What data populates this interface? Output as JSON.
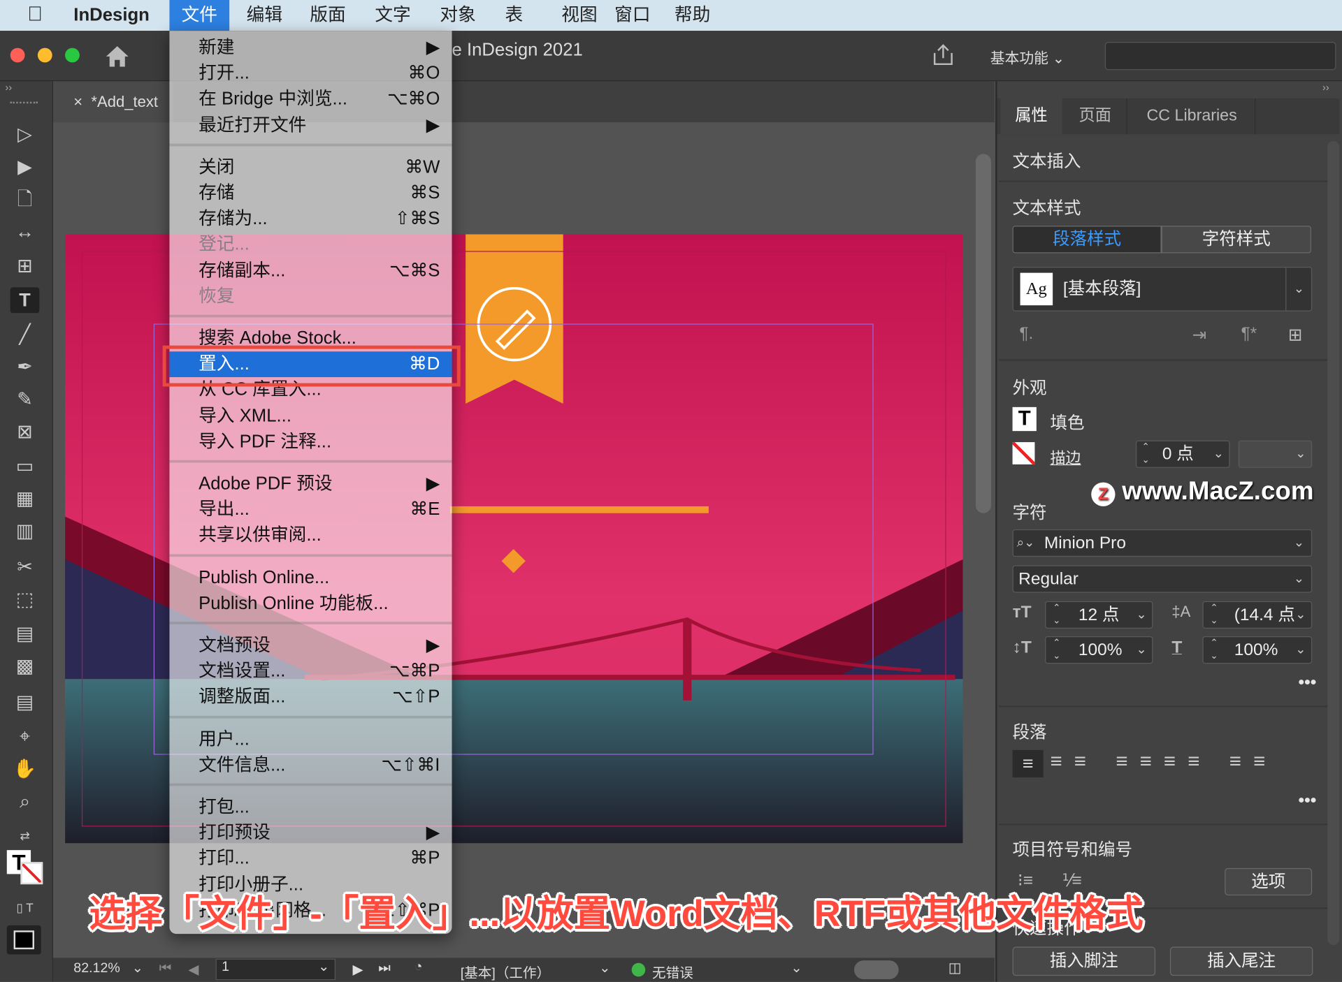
{
  "menubar": {
    "apple_icon": "apple-icon",
    "app_name": "InDesign",
    "items": [
      "文件",
      "编辑",
      "版面",
      "文字",
      "对象",
      "表",
      "视图",
      "窗口",
      "帮助"
    ],
    "active_index": 0
  },
  "window": {
    "title": "Adobe InDesign 2021",
    "title_visible": "e InDesign 2021",
    "workspace": "基本功能",
    "search_placeholder": "",
    "doc_tab": "*Add_text",
    "traffic_lights": [
      "#fe5f57",
      "#febc2e",
      "#28c840"
    ]
  },
  "file_menu": {
    "groups": [
      [
        {
          "label": "新建",
          "shortcut": "▶"
        },
        {
          "label": "打开...",
          "shortcut": "⌘O"
        },
        {
          "label": "在 Bridge 中浏览...",
          "shortcut": "⌥⌘O"
        },
        {
          "label": "最近打开文件",
          "shortcut": "▶"
        }
      ],
      [
        {
          "label": "关闭",
          "shortcut": "⌘W"
        },
        {
          "label": "存储",
          "shortcut": "⌘S"
        },
        {
          "label": "存储为...",
          "shortcut": "⇧⌘S"
        },
        {
          "label": "登记...",
          "shortcut": "",
          "disabled": true
        },
        {
          "label": "存储副本...",
          "shortcut": "⌥⌘S"
        },
        {
          "label": "恢复",
          "shortcut": "",
          "disabled": true
        }
      ],
      [
        {
          "label": "搜索 Adobe Stock...",
          "shortcut": ""
        },
        {
          "label": "置入...",
          "shortcut": "⌘D",
          "highlighted": true
        },
        {
          "label": "从 CC 库置入...",
          "shortcut": ""
        },
        {
          "label": "导入 XML...",
          "shortcut": ""
        },
        {
          "label": "导入 PDF 注释...",
          "shortcut": ""
        }
      ],
      [
        {
          "label": "Adobe PDF 预设",
          "shortcut": "▶"
        },
        {
          "label": "导出...",
          "shortcut": "⌘E"
        },
        {
          "label": "共享以供审阅...",
          "shortcut": ""
        }
      ],
      [
        {
          "label": "Publish Online...",
          "shortcut": ""
        },
        {
          "label": "Publish Online 功能板...",
          "shortcut": ""
        }
      ],
      [
        {
          "label": "文档预设",
          "shortcut": "▶"
        },
        {
          "label": "文档设置...",
          "shortcut": "⌥⌘P"
        },
        {
          "label": "调整版面...",
          "shortcut": "⌥⇧P"
        }
      ],
      [
        {
          "label": "用户...",
          "shortcut": ""
        },
        {
          "label": "文件信息...",
          "shortcut": "⌥⇧⌘I"
        }
      ],
      [
        {
          "label": "打包...",
          "shortcut": ""
        },
        {
          "label": "打印预设",
          "shortcut": "▶"
        },
        {
          "label": "打印...",
          "shortcut": "⌘P"
        },
        {
          "label": "打印小册子...",
          "shortcut": ""
        },
        {
          "label": "打印/导出网格...",
          "shortcut": "⌥⇧⌘P"
        }
      ]
    ],
    "highlight_color": "#1f6fd8",
    "callout_color": "#e94a3b"
  },
  "properties_panel": {
    "tabs": [
      "属性",
      "页面",
      "CC Libraries"
    ],
    "active_tab": 0,
    "section_text_insert": "文本插入",
    "section_text_style": "文本样式",
    "style_tabs": [
      "段落样式",
      "字符样式"
    ],
    "style_preview": "Ag",
    "paragraph_style": "[基本段落]",
    "section_appearance": "外观",
    "fill_label": "填色",
    "stroke_label": "描边",
    "stroke_weight": "0 点",
    "section_character": "字符",
    "font_family": "Minion Pro",
    "font_style": "Regular",
    "font_size": "12 点",
    "leading": "(14.4 点)",
    "vertical_scale": "100%",
    "horizontal_scale": "100%",
    "section_paragraph": "段落",
    "section_bullets": "项目符号和编号",
    "options_button": "选项",
    "section_quick_actions": "快速操作",
    "insert_footnote": "插入脚注",
    "insert_endnote": "插入尾注"
  },
  "status_bar": {
    "zoom": "82.12%",
    "page": "1",
    "profile": "[基本]（工作）",
    "preflight": "无错误",
    "preflight_color": "#3fb54a"
  },
  "caption": "选择「文件」-「置入」...以放置Word文档、RTF或其他文件格式",
  "watermark": "www.MacZ.com"
}
